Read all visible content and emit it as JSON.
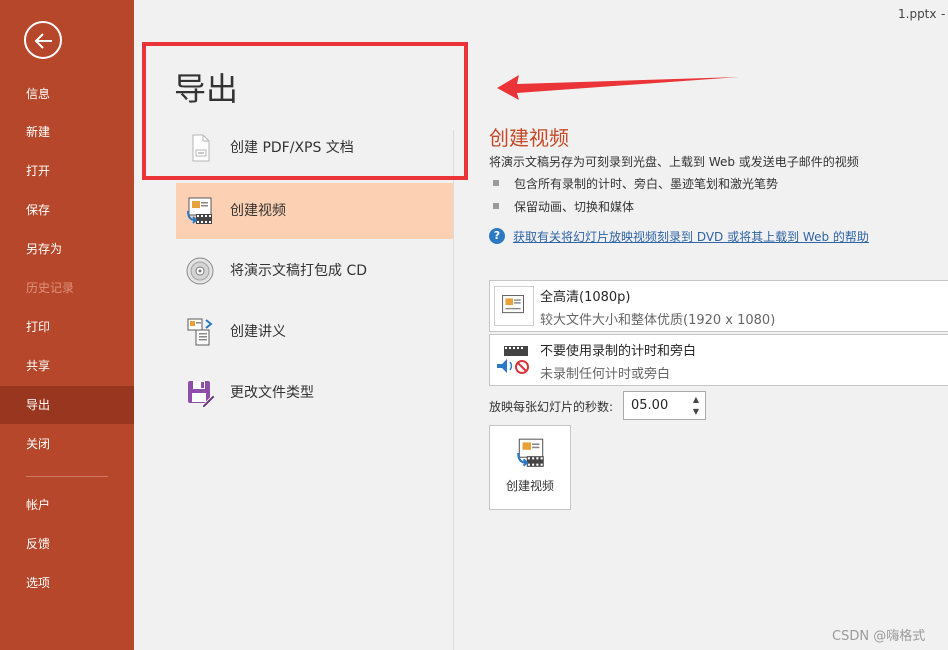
{
  "window": {
    "file_name": "1.pptx",
    "title_dash": "-"
  },
  "sidebar": {
    "items": [
      {
        "label": "信息"
      },
      {
        "label": "新建"
      },
      {
        "label": "打开"
      },
      {
        "label": "保存"
      },
      {
        "label": "另存为"
      },
      {
        "label": "历史记录"
      },
      {
        "label": "打印"
      },
      {
        "label": "共享"
      },
      {
        "label": "导出"
      },
      {
        "label": "关闭"
      },
      {
        "label": "帐户"
      },
      {
        "label": "反馈"
      },
      {
        "label": "选项"
      }
    ]
  },
  "export": {
    "title": "导出",
    "items": [
      {
        "label": "创建 PDF/XPS 文档"
      },
      {
        "label": "创建视频"
      },
      {
        "label": "将演示文稿打包成 CD"
      },
      {
        "label": "创建讲义"
      },
      {
        "label": "更改文件类型"
      }
    ]
  },
  "panel": {
    "title": "创建视频",
    "description": "将演示文稿另存为可刻录到光盘、上载到 Web 或发送电子邮件的视频",
    "bullets": [
      "包含所有录制的计时、旁白、墨迹笔划和激光笔势",
      "保留动画、切换和媒体"
    ],
    "help_link": "获取有关将幻灯片放映视频刻录到 DVD 或将其上载到 Web 的帮助",
    "quality": {
      "title": "全高清(1080p)",
      "subtitle": "较大文件大小和整体优质(1920 x 1080)"
    },
    "timing": {
      "title": "不要使用录制的计时和旁白",
      "subtitle": "未录制任何计时或旁白"
    },
    "seconds_label": "放映每张幻灯片的秒数:",
    "seconds_value": "05.00",
    "create_button": "创建视频"
  },
  "watermark": "CSDN @嗨格式",
  "colors": {
    "sidebar": "#b7472a",
    "selected_nav": "#99361f",
    "selected_item": "#fcd0b3",
    "accent_title": "#c64a28",
    "annotation": "#ea3438"
  }
}
